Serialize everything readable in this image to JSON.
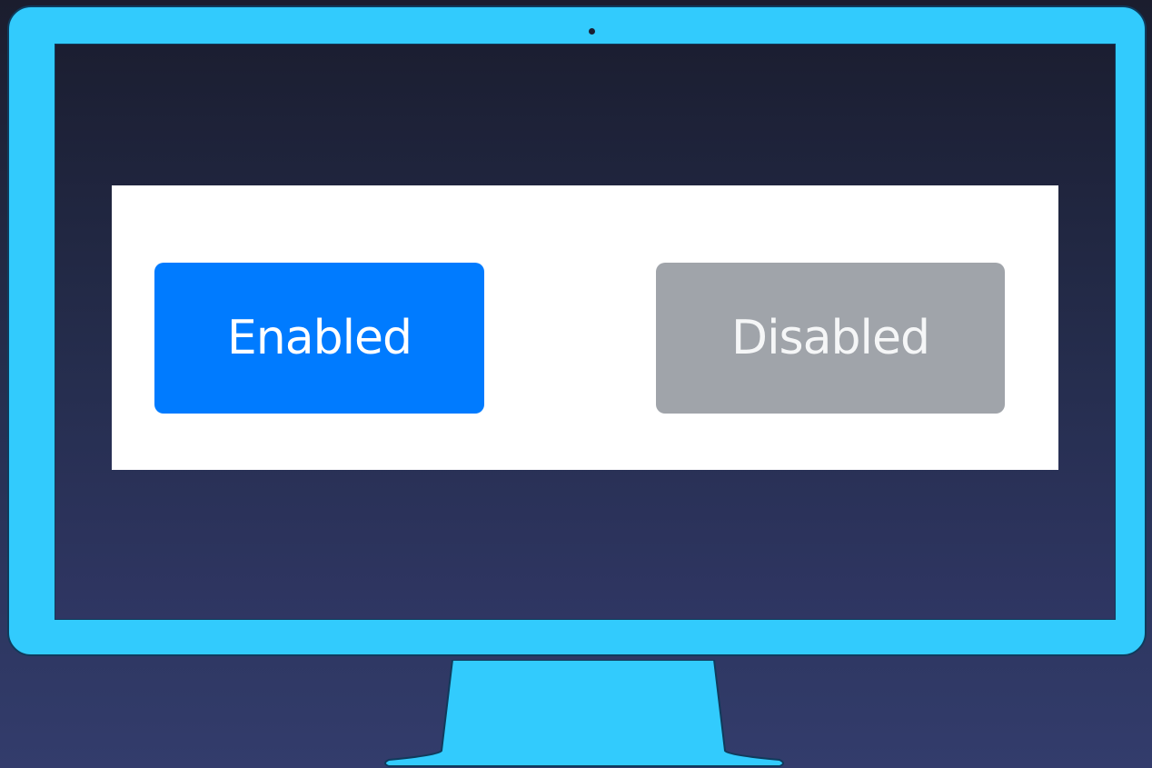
{
  "buttons": {
    "enabled": {
      "label": "Enabled",
      "state": "enabled",
      "color": "#007bff"
    },
    "disabled": {
      "label": "Disabled",
      "state": "disabled",
      "color": "#a0a4aa"
    }
  },
  "theme": {
    "monitor_color": "#32cbfd",
    "background_color": "#2a3158",
    "panel_color": "#ffffff"
  },
  "icons": {
    "monitor": "monitor-icon",
    "camera": "camera-dot-icon"
  }
}
